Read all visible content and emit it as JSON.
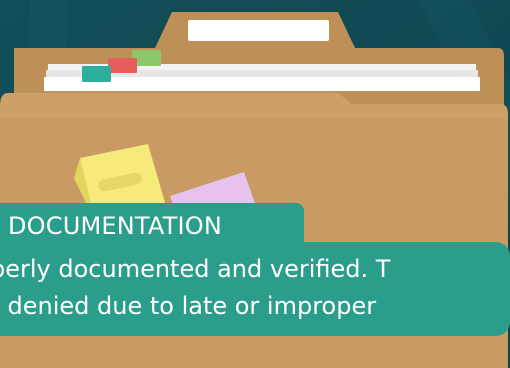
{
  "card": {
    "label": "DOCUMENTATION",
    "line_1": "perly documented and verified. T",
    "line_2": "r denied due to late or improper"
  },
  "colors": {
    "background": "#0f4d57",
    "folder": "#c99a63",
    "label_band": "#2a9e8a",
    "sticky_yellow": "#f5ea7a",
    "sticky_pink": "#e7c2ee",
    "tab_teal": "#2ab09b",
    "tab_red": "#e95c5c",
    "tab_green": "#8cc86a",
    "text": "#ffffff"
  },
  "icons": {
    "folder": "folder-icon",
    "sticky_note_yellow": "sticky-note-icon",
    "sticky_note_pink": "sticky-note-icon"
  }
}
